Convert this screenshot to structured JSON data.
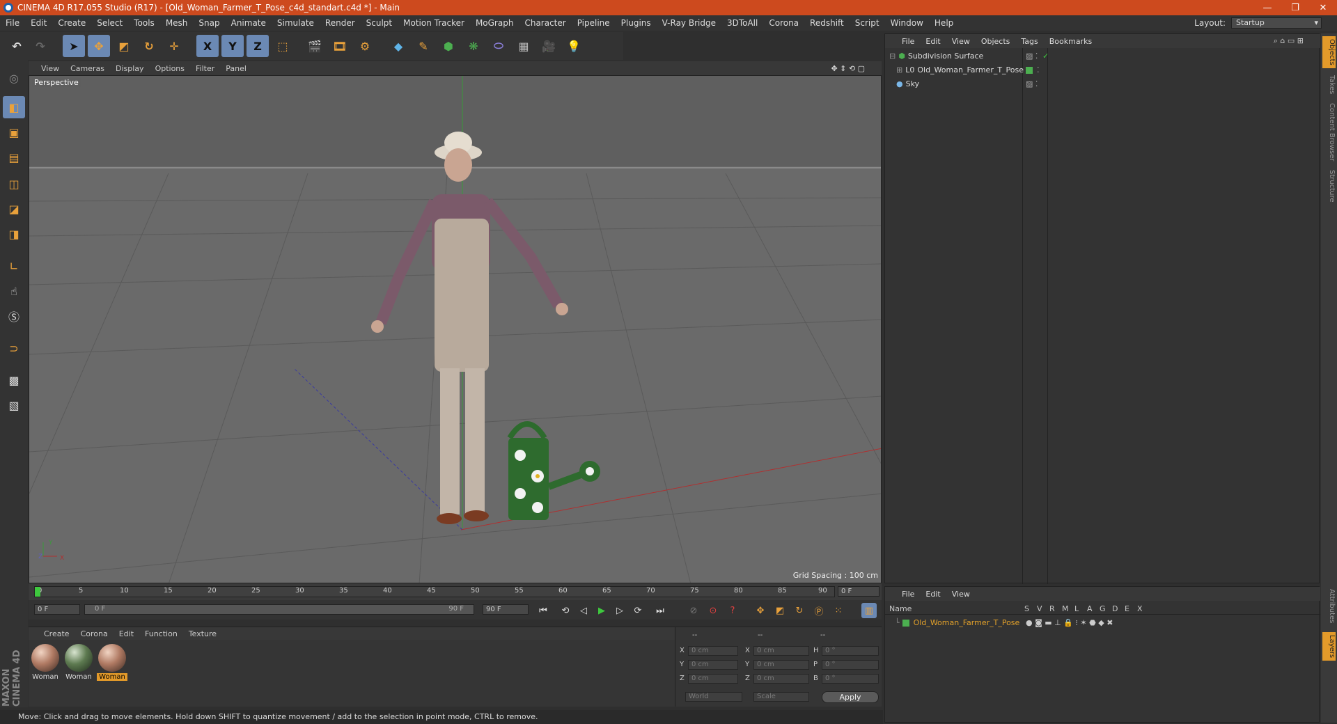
{
  "window": {
    "title": "CINEMA 4D R17.055 Studio (R17) - [Old_Woman_Farmer_T_Pose_c4d_standart.c4d *] - Main"
  },
  "menu": [
    "File",
    "Edit",
    "Create",
    "Select",
    "Tools",
    "Mesh",
    "Snap",
    "Animate",
    "Simulate",
    "Render",
    "Sculpt",
    "Motion Tracker",
    "MoGraph",
    "Character",
    "Pipeline",
    "Plugins",
    "V-Ray Bridge",
    "3DToAll",
    "Corona",
    "Redshift",
    "Script",
    "Window",
    "Help"
  ],
  "layout": {
    "label": "Layout:",
    "value": "Startup"
  },
  "toolbar": {
    "x_label": "X",
    "y_label": "Y",
    "z_label": "Z"
  },
  "viewport": {
    "menu": [
      "View",
      "Cameras",
      "Display",
      "Options",
      "Filter",
      "Panel"
    ],
    "label": "Perspective",
    "grid_spacing": "Grid Spacing : 100 cm",
    "axis_y": "Y",
    "axis_x": "X",
    "axis_z": "Z"
  },
  "timeline": {
    "ticks": [
      "0",
      "5",
      "10",
      "15",
      "20",
      "25",
      "30",
      "35",
      "40",
      "45",
      "50",
      "55",
      "60",
      "65",
      "70",
      "75",
      "80",
      "85",
      "90"
    ],
    "current": "0 F",
    "start": "0 F",
    "range_start": "0 F",
    "range_end": "90 F",
    "end": "90 F"
  },
  "materials": {
    "menu": [
      "Create",
      "Corona",
      "Edit",
      "Function",
      "Texture"
    ],
    "items": [
      {
        "name": "Woman"
      },
      {
        "name": "Woman"
      },
      {
        "name": "Woman"
      }
    ]
  },
  "coords": {
    "header": [
      "--",
      "--",
      "--"
    ],
    "rows": [
      {
        "a": "X",
        "av": "0 cm",
        "b": "X",
        "bv": "0 cm",
        "c": "H",
        "cv": "0 °"
      },
      {
        "a": "Y",
        "av": "0 cm",
        "b": "Y",
        "bv": "0 cm",
        "c": "P",
        "cv": "0 °"
      },
      {
        "a": "Z",
        "av": "0 cm",
        "b": "Z",
        "bv": "0 cm",
        "c": "B",
        "cv": "0 °"
      }
    ],
    "mode1": "World",
    "mode2": "Scale",
    "apply": "Apply"
  },
  "objects": {
    "menu": [
      "File",
      "Edit",
      "View",
      "Objects",
      "Tags",
      "Bookmarks"
    ],
    "items": [
      {
        "name": "Subdivision Surface"
      },
      {
        "name": "Old_Woman_Farmer_T_Pose"
      },
      {
        "name": "Sky"
      }
    ]
  },
  "layers": {
    "menu": [
      "File",
      "Edit",
      "View"
    ],
    "columns": [
      "Name",
      "S",
      "V",
      "R",
      "M",
      "L",
      "A",
      "G",
      "D",
      "E",
      "X"
    ],
    "items": [
      {
        "name": "Old_Woman_Farmer_T_Pose"
      }
    ]
  },
  "side_tabs": [
    "Objects",
    "Takes",
    "Content Browser",
    "Structure",
    "Attributes",
    "Layers"
  ],
  "branding": "MAXON CINEMA 4D",
  "status": "Move: Click and drag to move elements. Hold down SHIFT to quantize movement / add to the selection in point mode, CTRL to remove.",
  "colors": {
    "titlebar": "#cd4a1e",
    "accent": "#e39a2a",
    "tool_active": "#6b89b4",
    "viewport": "#6a6a6a"
  }
}
